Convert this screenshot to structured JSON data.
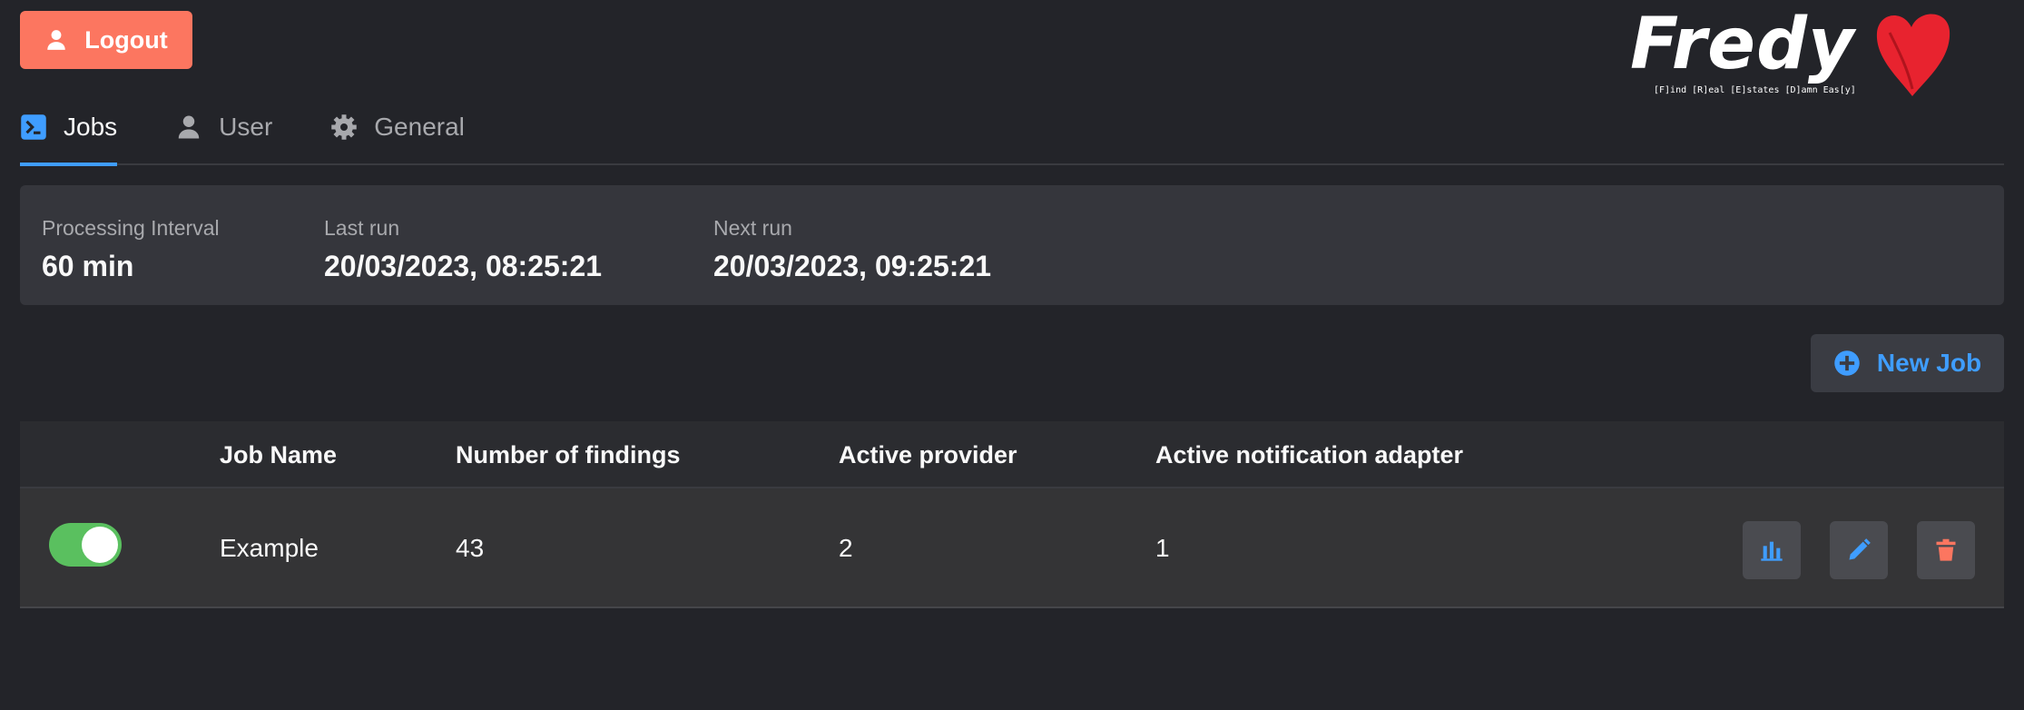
{
  "header": {
    "logout_label": "Logout",
    "logo_text": "Fredy",
    "logo_tagline": "[F]ind [R]eal [E]states [D]amn Eas[y]"
  },
  "tabs": [
    {
      "label": "Jobs",
      "icon": "terminal-icon",
      "active": true
    },
    {
      "label": "User",
      "icon": "user-icon",
      "active": false
    },
    {
      "label": "General",
      "icon": "gear-icon",
      "active": false
    }
  ],
  "info": {
    "processing_interval_label": "Processing Interval",
    "processing_interval_value": "60 min",
    "last_run_label": "Last run",
    "last_run_value": "20/03/2023, 08:25:21",
    "next_run_label": "Next run",
    "next_run_value": "20/03/2023, 09:25:21"
  },
  "new_job_label": "New Job",
  "table": {
    "columns": [
      "Job Name",
      "Number of findings",
      "Active provider",
      "Active notification adapter"
    ],
    "rows": [
      {
        "enabled": true,
        "name": "Example",
        "findings": "43",
        "providers": "2",
        "adapters": "1"
      }
    ]
  },
  "colors": {
    "accent": "#3f9dff",
    "danger": "#fc7660",
    "toggle_on": "#5ac05f",
    "background": "#232429"
  }
}
